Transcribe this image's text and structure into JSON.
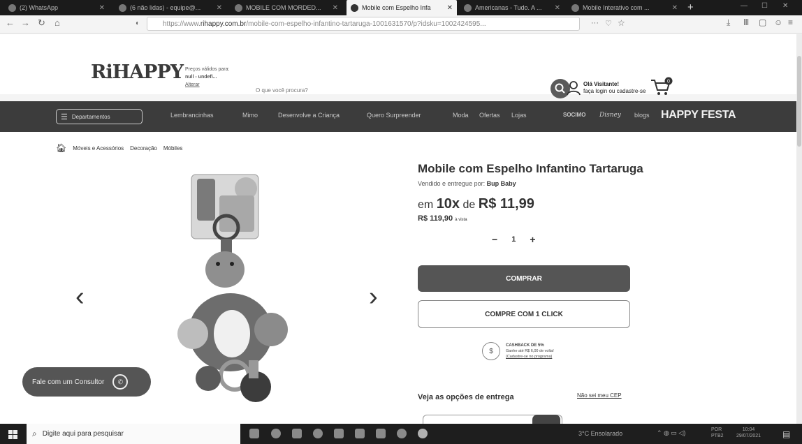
{
  "browser": {
    "tabs": [
      {
        "label": "(2) WhatsApp",
        "active": false
      },
      {
        "label": "(6 não lidas) - equipe@...",
        "active": false
      },
      {
        "label": "MOBILE COM MORDED...",
        "active": false
      },
      {
        "label": "Mobile com Espelho Infa",
        "active": true
      },
      {
        "label": "Americanas - Tudo. A ...",
        "active": false
      },
      {
        "label": "Mobile Interativo com ...",
        "active": false
      }
    ],
    "url_prefix": "https://www.",
    "url_host": "rihappy.com.br",
    "url_path": "/mobile-com-espelho-infantino-tartaruga-1001631570/p?idsku=1002424595..."
  },
  "header": {
    "logo_text": "RiHAPPY",
    "price_hint_line1": "Preços válidos para:",
    "price_hint_line2": "null - undefi...",
    "price_hint_link": "Alterar",
    "search_placeholder": "O que você procura?",
    "greeting": "Olá Visitante!",
    "login_text": "faça login ou cadastre-se",
    "cart_count": "0"
  },
  "nav": {
    "departments_label": "Departamentos",
    "links": [
      "Lembrancinhas",
      "Mimo",
      "Desenvolve a Criança",
      "Quero Surpreender",
      "Moda",
      "Ofertas",
      "Lojas"
    ],
    "brand_links": [
      "SOCIMO",
      "Disney",
      "blogs"
    ],
    "happy_festa": "HAPPY FESTA"
  },
  "breadcrumb": [
    "Móveis e Acessórios",
    "Decoração",
    "Móbiles"
  ],
  "product": {
    "title": "Mobile com Espelho Infantino Tartaruga",
    "seller_prefix": "Vendido e entregue por:",
    "seller": "Bup Baby",
    "installment_prefix": "em",
    "installment_count": "10x",
    "installment_mid": "de",
    "installment_value": "R$ 11,99",
    "cash_price": "R$ 119,90",
    "cash_suffix": "à vista",
    "quantity": "1",
    "buy_label": "COMPRAR",
    "one_click_label": "COMPRE COM 1 CLICK",
    "cashback_title": "CASHBACK DE 5%",
    "cashback_line": "Ganhe até R$ 6,00 de volta!",
    "cashback_link": "(Cadastre-se no programa)",
    "delivery_label": "Veja as opções de entrega",
    "no_cep_label": "Não sei meu CEP"
  },
  "chat": {
    "label": "Fale com um Consultor"
  },
  "taskbar": {
    "search_placeholder": "Digite aqui para pesquisar",
    "weather": "3°C  Ensolarado",
    "lang_line1": "POR",
    "lang_line2": "PTB2",
    "time": "10:04",
    "date": "29/07/2021"
  }
}
